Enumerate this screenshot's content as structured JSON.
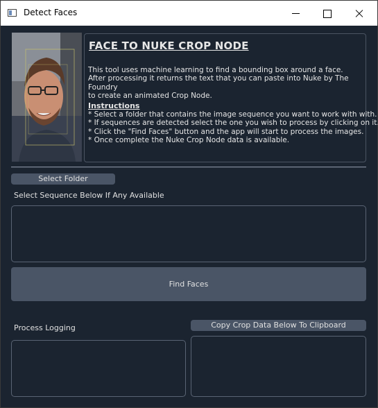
{
  "window": {
    "title": "Detect Faces",
    "icon": "app-window-icon"
  },
  "info": {
    "heading": "FACE TO NUKE CROP NODE",
    "description_lines": [
      "This tool uses machine learning to find a bounding box around a face.",
      "After processing it returns the text that you can paste into Nuke by The Foundry",
      "to create an animated Crop Node."
    ],
    "instructions_title": "Instructions",
    "instructions": [
      "* Select a folder that contains the image sequence you want to work with with.",
      "* If sequences are detected select the one you wish to process by clicking on it.",
      "* Click the \"Find Faces\" button and the app will start to process the images.",
      "* Once complete the Nuke Crop Node data is available."
    ]
  },
  "controls": {
    "select_folder_label": "Select Folder",
    "sequence_label": "Select Sequence Below If Any Available",
    "find_faces_label": "Find Faces",
    "process_logging_label": "Process Logging",
    "copy_crop_label": "Copy Crop Data Below To Clipboard"
  },
  "colors": {
    "background": "#1b2430",
    "button": "#4a5566",
    "text": "#e6e6e6",
    "face_box": "#c9c36a"
  }
}
